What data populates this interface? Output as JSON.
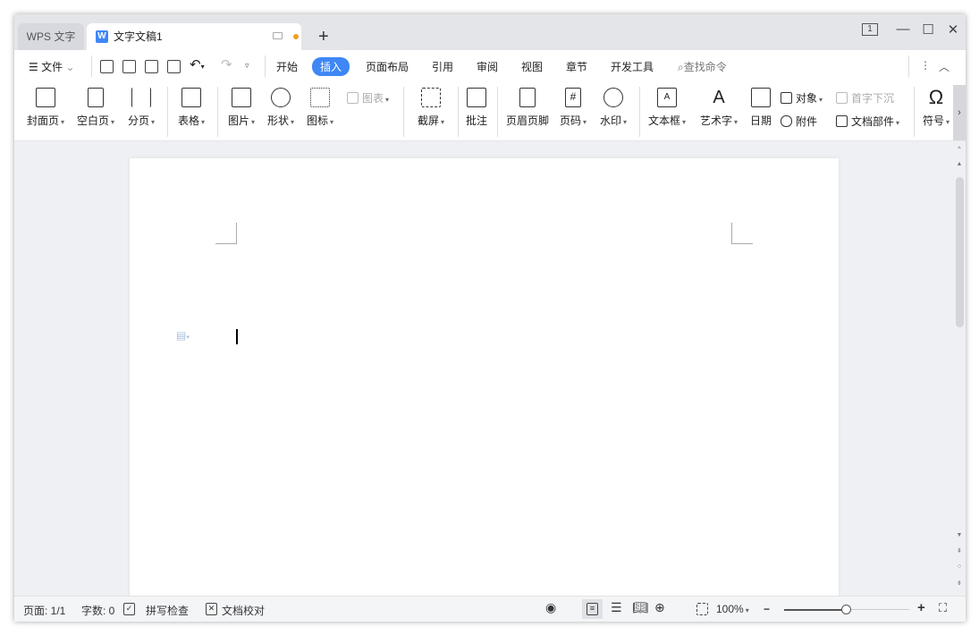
{
  "tabs": [
    {
      "label": "WPS 文字"
    },
    {
      "label": "文字文稿1"
    }
  ],
  "menu": {
    "file": "文件",
    "items": [
      "开始",
      "插入",
      "页面布局",
      "引用",
      "审阅",
      "视图",
      "章节",
      "开发工具"
    ],
    "active": "插入",
    "search": "查找命令"
  },
  "ribbon": {
    "cover": "封面页",
    "blank": "空白页",
    "pagebreak": "分页",
    "table": "表格",
    "picture": "图片",
    "shape": "形状",
    "icon": "图标",
    "chart": "图表",
    "screenshot": "截屏",
    "comment": "批注",
    "headerfooter": "页眉页脚",
    "pagenum": "页码",
    "watermark": "水印",
    "textbox": "文本框",
    "wordart": "艺术字",
    "date": "日期",
    "object": "对象",
    "dropcap": "首字下沉",
    "attachment": "附件",
    "docpart": "文档部件",
    "symbol": "符号"
  },
  "status": {
    "page": "页面: 1/1",
    "words": "字数: 0",
    "spell": "拼写检查",
    "proof": "文档校对",
    "zoom": "100%"
  },
  "zoom_level": 100,
  "window": {
    "tab_counter": "1"
  }
}
